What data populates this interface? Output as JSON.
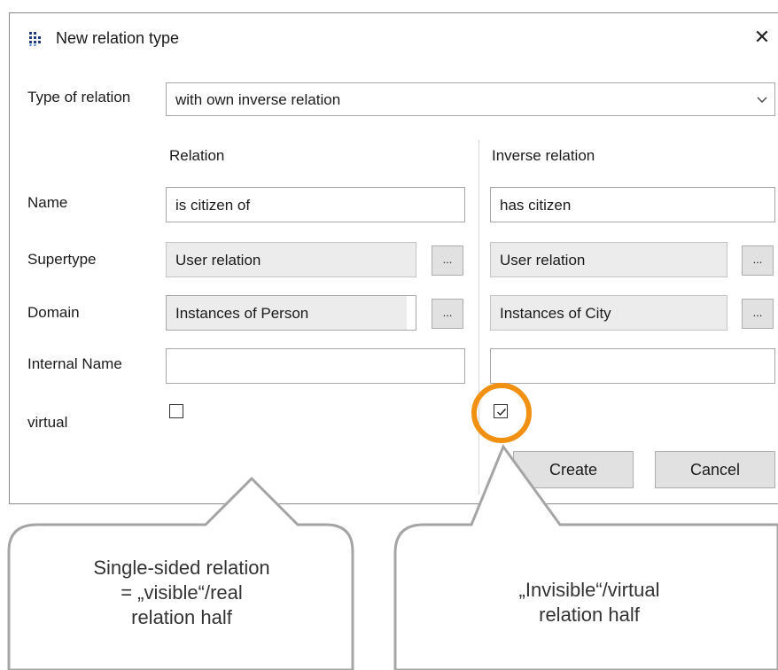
{
  "dialog": {
    "title": "New relation type",
    "icons": {
      "app": "app-dots-icon",
      "close": "close-icon"
    },
    "close_glyph": "✕",
    "type_label": "Type of relation",
    "type_value": "with own inverse relation",
    "columns": {
      "left": "Relation",
      "right": "Inverse relation"
    },
    "labels": {
      "name": "Name",
      "supertype": "Supertype",
      "domain": "Domain",
      "internal_name": "Internal Name",
      "virtual": "virtual"
    },
    "relation": {
      "name": "is citizen of",
      "supertype": "User relation",
      "domain": "Instances of Person",
      "internal_name": "",
      "virtual": false
    },
    "inverse": {
      "name": "has citizen",
      "supertype": "User relation",
      "domain": "Instances of City",
      "internal_name": "",
      "virtual": true
    },
    "browse_label": "...",
    "buttons": {
      "create": "Create",
      "cancel": "Cancel"
    }
  },
  "annotations": {
    "left_line1": "Single-sided relation",
    "left_line2": "= „visible“/real",
    "left_line3": "relation half",
    "right_line1": "„Invisible“/virtual",
    "right_line2": "relation half",
    "highlight_color": "#f29111",
    "callout_border": "#a5a5a5"
  }
}
